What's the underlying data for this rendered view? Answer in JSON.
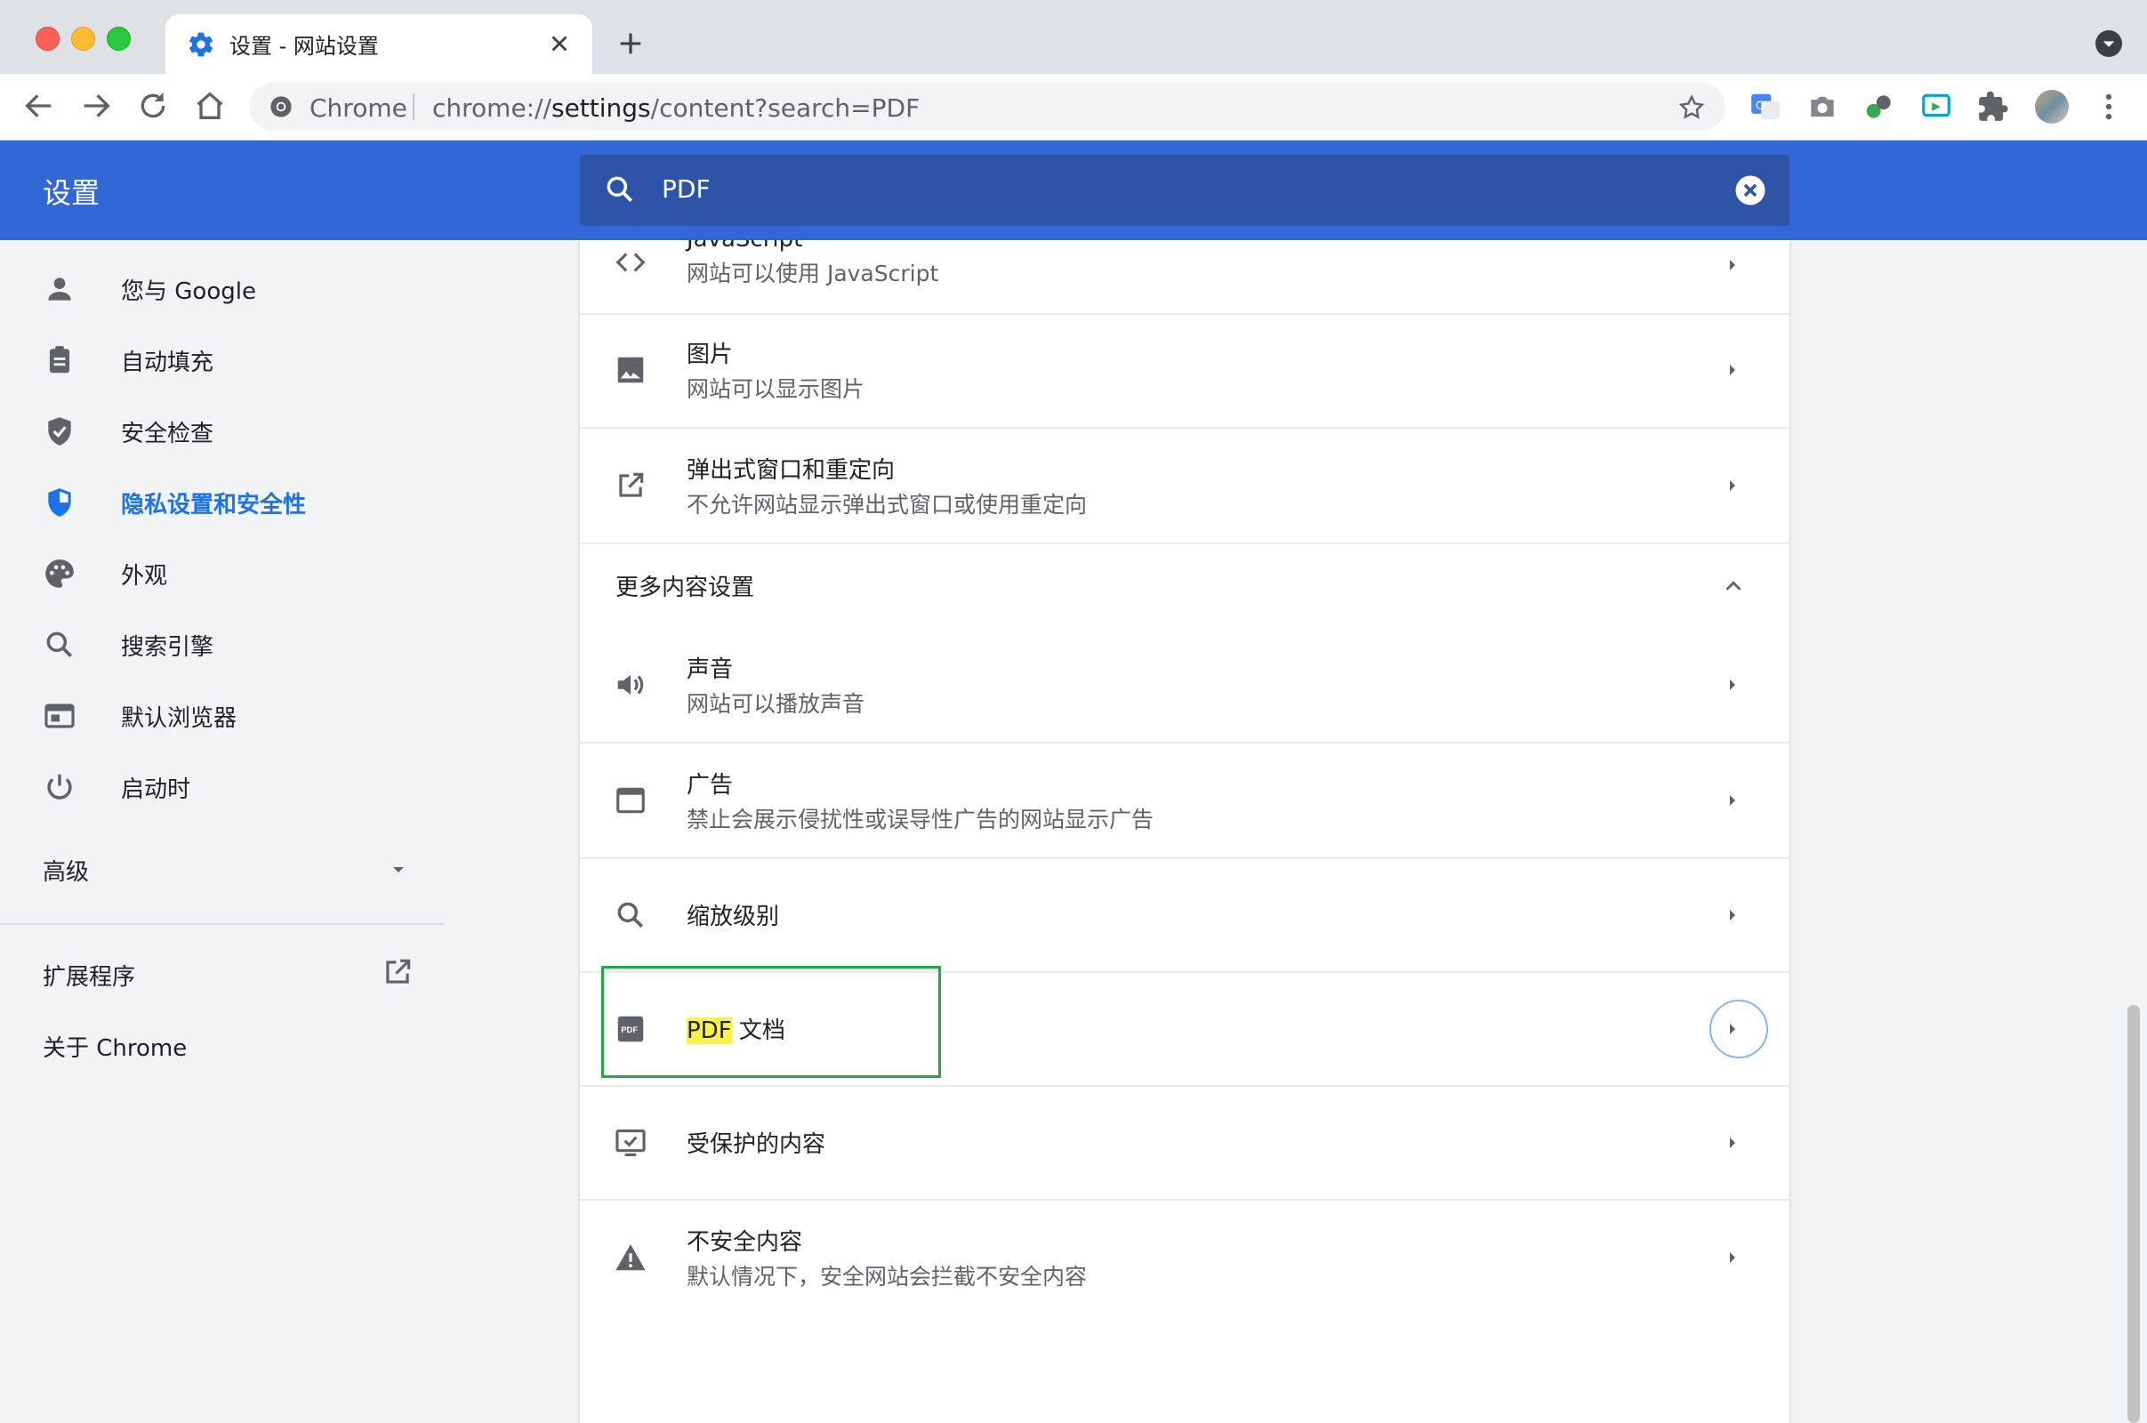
{
  "browser": {
    "tab_title": "设置 - 网站设置",
    "omnibox": {
      "site_label": "Chrome",
      "url_prefix": "chrome://",
      "url_host": "settings",
      "url_path": "/content?search=PDF"
    }
  },
  "header": {
    "title": "设置",
    "search_value": "PDF"
  },
  "sidebar": {
    "items": [
      {
        "label": "您与 Google",
        "icon": "person-icon"
      },
      {
        "label": "自动填充",
        "icon": "clipboard-icon"
      },
      {
        "label": "安全检查",
        "icon": "shield-check-icon"
      },
      {
        "label": "隐私设置和安全性",
        "icon": "privacy-shield-icon",
        "active": true
      },
      {
        "label": "外观",
        "icon": "palette-icon"
      },
      {
        "label": "搜索引擎",
        "icon": "search-icon"
      },
      {
        "label": "默认浏览器",
        "icon": "browser-window-icon"
      },
      {
        "label": "启动时",
        "icon": "power-icon"
      }
    ],
    "advanced_label": "高级",
    "extensions_label": "扩展程序",
    "about_label": "关于 Chrome"
  },
  "content": {
    "partial_row": {
      "title": "JavaScript",
      "sub": "网站可以使用 JavaScript"
    },
    "images": {
      "title": "图片",
      "sub": "网站可以显示图片"
    },
    "popups": {
      "title": "弹出式窗口和重定向",
      "sub": "不允许网站显示弹出式窗口或使用重定向"
    },
    "more_settings": "更多内容设置",
    "sound": {
      "title": "声音",
      "sub": "网站可以播放声音"
    },
    "ads": {
      "title": "广告",
      "sub": "禁止会展示侵扰性或误导性广告的网站显示广告"
    },
    "zoom": {
      "title": "缩放级别"
    },
    "pdf": {
      "title_hl": "PDF",
      "title_rest": " 文档"
    },
    "protected": {
      "title": "受保护的内容"
    },
    "insecure": {
      "title": "不安全内容",
      "sub": "默认情况下，安全网站会拦截不安全内容"
    }
  },
  "colors": {
    "header": "#3367d6",
    "accent": "#1a73e8",
    "highlight": "#fcf245",
    "annotation": "#22a94b"
  }
}
